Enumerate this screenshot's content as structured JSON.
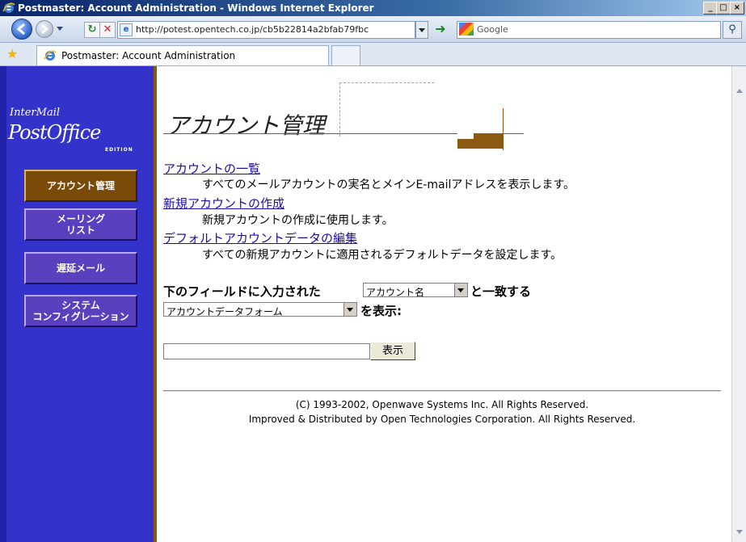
{
  "window": {
    "title": "Postmaster: Account Administration - Windows Internet Explorer",
    "controls": [
      "_",
      "□",
      "×"
    ]
  },
  "browser": {
    "address": "http://potest.opentech.co.jp/cb5b22814a2bfab79fbc",
    "search_placeholder": "Google",
    "tab_label": "Postmaster: Account Administration"
  },
  "sidebar": {
    "logo": {
      "line1": "InterMail",
      "line2": "PostOffice",
      "edition": "EDITION"
    },
    "items": [
      {
        "label": "アカウント管理",
        "active": true
      },
      {
        "label": "メーリング\nリスト",
        "active": false
      },
      {
        "label": "遅延メール",
        "active": false
      },
      {
        "label": "システム\nコンフィグレーション",
        "active": false
      }
    ]
  },
  "main": {
    "title": "アカウント管理",
    "links": [
      {
        "label": "アカウントの一覧",
        "description": "すべてのメールアカウントの実名とメインE-mailアドレスを表示します。"
      },
      {
        "label": "新規アカウントの作成",
        "description": "新規アカウントの作成に使用します。"
      },
      {
        "label": "デフォルトアカウントデータの編集",
        "description": "すべての新規アカウントに適用されるデフォルトデータを設定します。"
      }
    ],
    "search": {
      "prefix": "下のフィールドに入力された",
      "field_select": "アカウント名",
      "match_text": "と一致する",
      "form_select": "アカウントデータフォーム",
      "show_text": "を表示:",
      "input_value": "",
      "button_label": "表示"
    },
    "footer": {
      "line1": "(C) 1993-2002, Openwave Systems Inc. All Rights Reserved.",
      "line2": "Improved & Distributed by Open Technologies Corporation. All Rights Reserved."
    }
  },
  "colors": {
    "sidebar_bg": "#3333cc",
    "accent_brown": "#8b5a10",
    "link": "#1a0dab"
  }
}
